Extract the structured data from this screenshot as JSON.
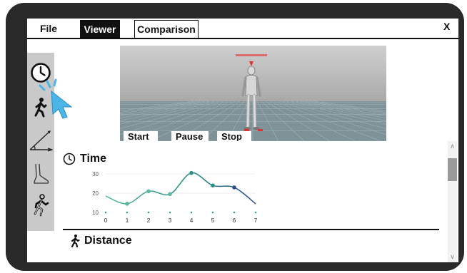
{
  "tabs": [
    {
      "label": "File"
    },
    {
      "label": "Viewer",
      "active": true
    },
    {
      "label": "Comparison"
    }
  ],
  "close_label": "X",
  "sidebar": {
    "items": [
      {
        "icon": "clock-icon",
        "selected": true
      },
      {
        "icon": "walking-person-icon"
      },
      {
        "icon": "angle-icon"
      },
      {
        "icon": "foot-icon"
      },
      {
        "icon": "running-person-icon"
      }
    ]
  },
  "viewer": {
    "controls": {
      "start": "Start",
      "pause": "Pause",
      "stop": "Stop"
    },
    "colors": {
      "sky": "#b9b9b9",
      "floor": "#7f9298",
      "grid": "#9fb0b5",
      "marker": "#e0312f"
    }
  },
  "time_section": {
    "title": "Time"
  },
  "distance_section": {
    "title": "Distance"
  },
  "chart_data": {
    "type": "line",
    "x": [
      0,
      1,
      2,
      3,
      4,
      5,
      6,
      7
    ],
    "y_ticks": [
      10,
      20,
      30
    ],
    "ylim": [
      10,
      30
    ],
    "series": [
      {
        "values": [
          18.5,
          14.5,
          21,
          19.5,
          30.5,
          24,
          23,
          14.5
        ],
        "marker_indices": [
          1,
          2,
          3,
          4,
          5,
          6
        ]
      }
    ],
    "colors": {
      "start": "#5fb9a2",
      "mid": "#2f8f88",
      "end": "#2f4f8f",
      "baseline_dots": "#3aa08a",
      "grid": "#dddddd"
    },
    "grid": true
  },
  "scrollbar": {
    "up": "∧",
    "down": "∨"
  }
}
